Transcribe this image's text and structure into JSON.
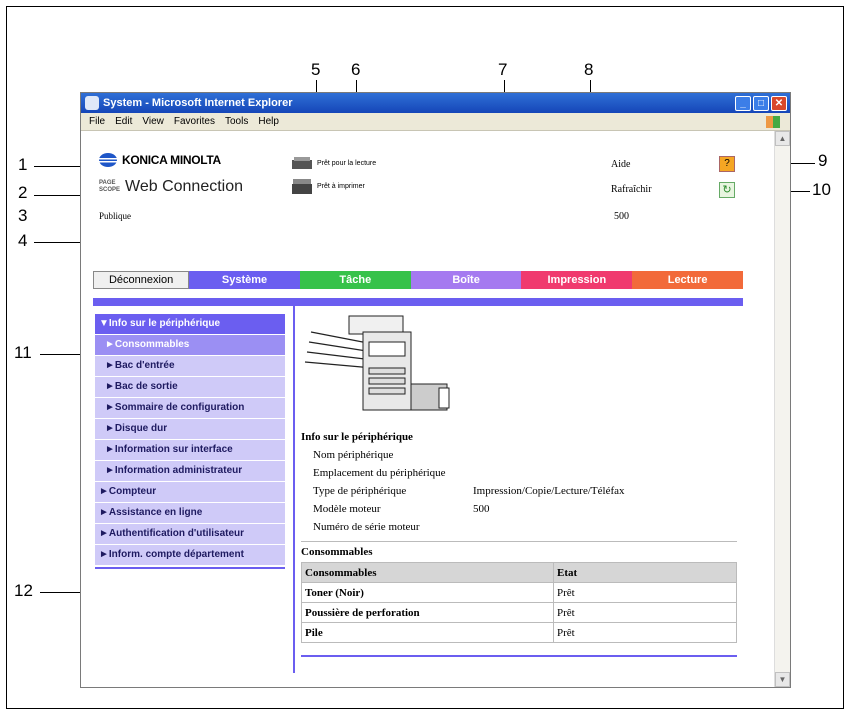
{
  "callouts": [
    "1",
    "2",
    "3",
    "4",
    "5",
    "6",
    "7",
    "8",
    "9",
    "10",
    "11",
    "12"
  ],
  "window": {
    "title": "System - Microsoft Internet Explorer",
    "menu": [
      "File",
      "Edit",
      "View",
      "Favorites",
      "Tools",
      "Help"
    ]
  },
  "header": {
    "brand": "KONICA MINOLTA",
    "pagescope_top": "PAGE",
    "pagescope_bottom": "SCOPE",
    "product": "Web Connection",
    "user_mode": "Publique",
    "status_read": "Prêt pour la lecture",
    "status_print": "Prêt à imprimer",
    "help_label": "Aide",
    "refresh_label": "Rafraîchir",
    "model": "500"
  },
  "tabs": {
    "logout": "Déconnexion",
    "system": "Système",
    "job": "Tâche",
    "box": "Boîte",
    "print": "Impression",
    "scan": "Lecture",
    "colors": {
      "system": "#6b5ef0",
      "job": "#36c24a",
      "box": "#a57af0",
      "print": "#f03a6e",
      "scan": "#f26a3a"
    }
  },
  "sidebar": {
    "head": "▼Info sur le périphérique",
    "items": [
      "►Consommables",
      "►Bac d'entrée",
      "►Bac de sortie",
      "►Sommaire de configuration",
      "►Disque dur",
      "►Information sur interface",
      "►Information administrateur"
    ],
    "top_items": [
      "►Compteur",
      "►Assistance en ligne",
      "►Authentification d'utilisateur",
      "►Inform. compte département"
    ]
  },
  "device_info": {
    "title": "Info sur le périphérique",
    "rows": [
      {
        "label": "Nom périphérique",
        "value": ""
      },
      {
        "label": "Emplacement du périphérique",
        "value": ""
      },
      {
        "label": "Type de périphérique",
        "value": "Impression/Copie/Lecture/Téléfax"
      },
      {
        "label": "Modèle moteur",
        "value": "500"
      },
      {
        "label": "Numéro de série moteur",
        "value": ""
      }
    ]
  },
  "consumables": {
    "title": "Consommables",
    "headers": [
      "Consommables",
      "Etat"
    ],
    "rows": [
      [
        "Toner (Noir)",
        "Prêt"
      ],
      [
        "Poussière de perforation",
        "Prêt"
      ],
      [
        "Pile",
        "Prêt"
      ]
    ]
  }
}
